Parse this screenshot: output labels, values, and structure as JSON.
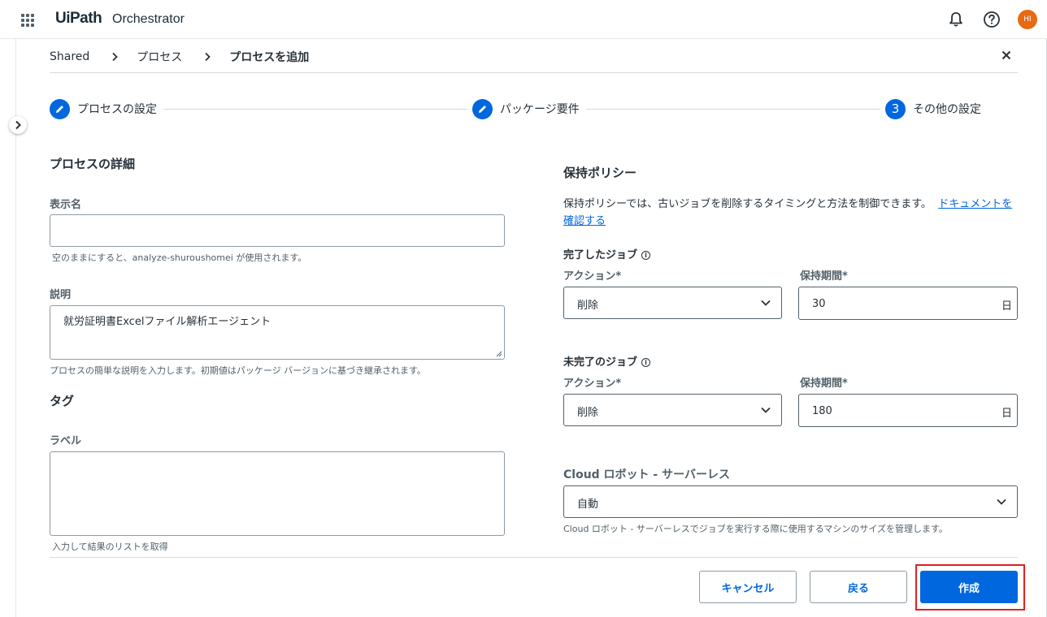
{
  "header": {
    "logo_text": "UiPath",
    "app_name": "Orchestrator",
    "avatar_initials": "HI"
  },
  "breadcrumb": {
    "items": [
      "Shared",
      "プロセス",
      "プロセスを追加"
    ]
  },
  "stepper": {
    "steps": [
      {
        "label": "プロセスの設定",
        "state": "completed",
        "icon": "pencil-icon"
      },
      {
        "label": "パッケージ要件",
        "state": "completed",
        "icon": "pencil-icon"
      },
      {
        "label": "その他の設定",
        "state": "current",
        "number": "3"
      }
    ]
  },
  "process_details": {
    "title": "プロセスの詳細",
    "display_name": {
      "label": "表示名",
      "value": "",
      "helper": "空のままにすると、analyze-shuroushomei が使用されます。"
    },
    "description": {
      "label": "説明",
      "value": "就労証明書Excelファイル解析エージェント",
      "helper": "プロセスの簡単な説明を入力します。初期値はパッケージ バージョンに基づき継承されます。"
    }
  },
  "tags": {
    "title": "タグ",
    "label_field": {
      "label": "ラベル",
      "value": "",
      "helper": "入力して結果のリストを取得"
    }
  },
  "retention": {
    "title": "保持ポリシー",
    "description": "保持ポリシーでは、古いジョブを削除するタイミングと方法を制御できます。",
    "doc_link": "ドキュメントを確認する",
    "completed_jobs": {
      "title": "完了したジョブ",
      "action_label": "アクション*",
      "action_value": "削除",
      "period_label": "保持期間*",
      "period_value": "30",
      "unit": "日"
    },
    "incomplete_jobs": {
      "title": "未完了のジョブ",
      "action_label": "アクション*",
      "action_value": "削除",
      "period_label": "保持期間*",
      "period_value": "180",
      "unit": "日"
    }
  },
  "cloud_robot": {
    "label": "Cloud ロボット - サーバーレス",
    "value": "自動",
    "helper": "Cloud ロボット - サーバーレスでジョブを実行する際に使用するマシンのサイズを管理します。"
  },
  "footer": {
    "cancel": "キャンセル",
    "back": "戻る",
    "create": "作成"
  },
  "colors": {
    "primary": "#0067df",
    "highlight": "#e0201b",
    "avatar": "#e76a14"
  }
}
